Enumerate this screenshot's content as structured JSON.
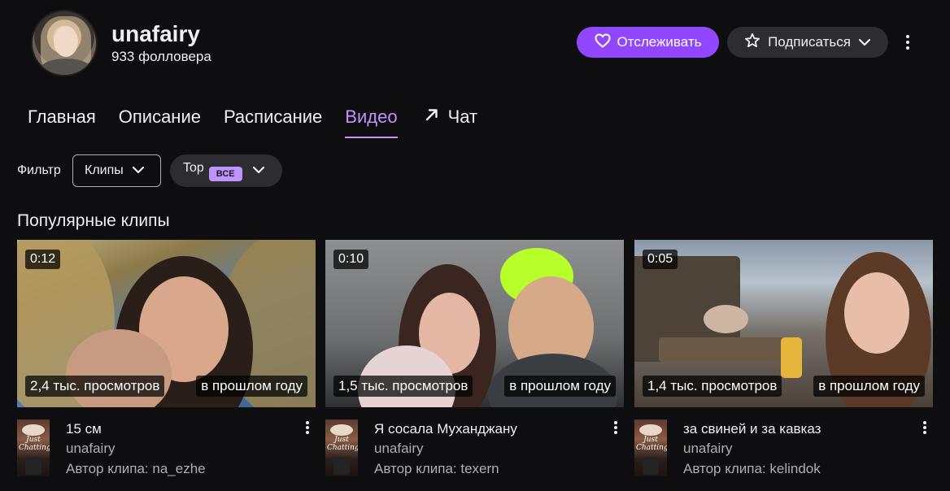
{
  "channel": {
    "name": "unafairy",
    "followers": "933 фолловера"
  },
  "actions": {
    "follow_label": "Отслеживать",
    "subscribe_label": "Подписаться"
  },
  "tabs": [
    {
      "label": "Главная"
    },
    {
      "label": "Описание"
    },
    {
      "label": "Расписание"
    },
    {
      "label": "Видео",
      "active": true
    },
    {
      "label": "Чат"
    }
  ],
  "filter": {
    "label": "Фильтр",
    "type_value": "Клипы",
    "sort_value": "Top",
    "sort_badge": "ВСЕ"
  },
  "section": {
    "title": "Популярные клипы"
  },
  "clips": [
    {
      "duration": "0:12",
      "views": "2,4 тыс. просмотров",
      "date": "в прошлом году",
      "title": "15 см",
      "channel": "unafairy",
      "author": "Автор клипа: na_ezhe"
    },
    {
      "duration": "0:10",
      "views": "1,5 тыс. просмотров",
      "date": "в прошлом году",
      "title": "Я сосала Муханджану",
      "channel": "unafairy",
      "author": "Автор клипа: texern"
    },
    {
      "duration": "0:05",
      "views": "1,4 тыс. просмотров",
      "date": "в прошлом году",
      "title": "за свиней и за кавказ",
      "channel": "unafairy",
      "author": "Автор клипа: kelindok"
    }
  ],
  "category_art_text": "Just Chatting",
  "colors": {
    "accent": "#9147ff",
    "accent_text": "#bf94ff",
    "background": "#0e0e10",
    "muted_text": "#adadb8"
  }
}
